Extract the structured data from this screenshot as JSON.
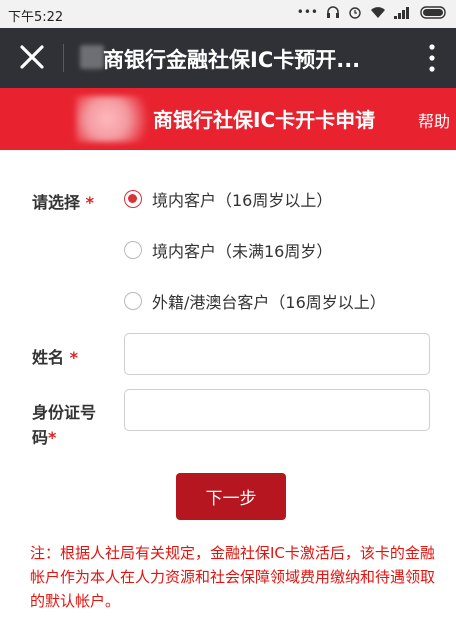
{
  "status_bar": {
    "time": "下午5:22"
  },
  "app_bar": {
    "title": "商银行金融社保IC卡预开..."
  },
  "banner": {
    "title": "商银行社保IC卡开卡申请",
    "help": "帮助"
  },
  "form": {
    "select_label": "请选择",
    "required_mark": "*",
    "options": [
      {
        "label": "境内客户（16周岁以上）",
        "selected": true
      },
      {
        "label": "境内客户（未满16周岁）",
        "selected": false
      },
      {
        "label": "外籍/港澳台客户（16周岁以上）",
        "selected": false
      }
    ],
    "name_label": "姓名",
    "name_value": "",
    "id_label_line1": "身份证号",
    "id_label_line2": "码",
    "id_value": "",
    "next_button": "下一步"
  },
  "note": "注：根据人社局有关规定，金融社保IC卡激活后，该卡的金融帐户作为本人在人力资源和社会保障领域费用缴纳和待遇领取的默认帐户。",
  "colors": {
    "banner": "#e8232f",
    "appbar": "#303136",
    "button": "#b5161f",
    "note": "#e3140f"
  }
}
